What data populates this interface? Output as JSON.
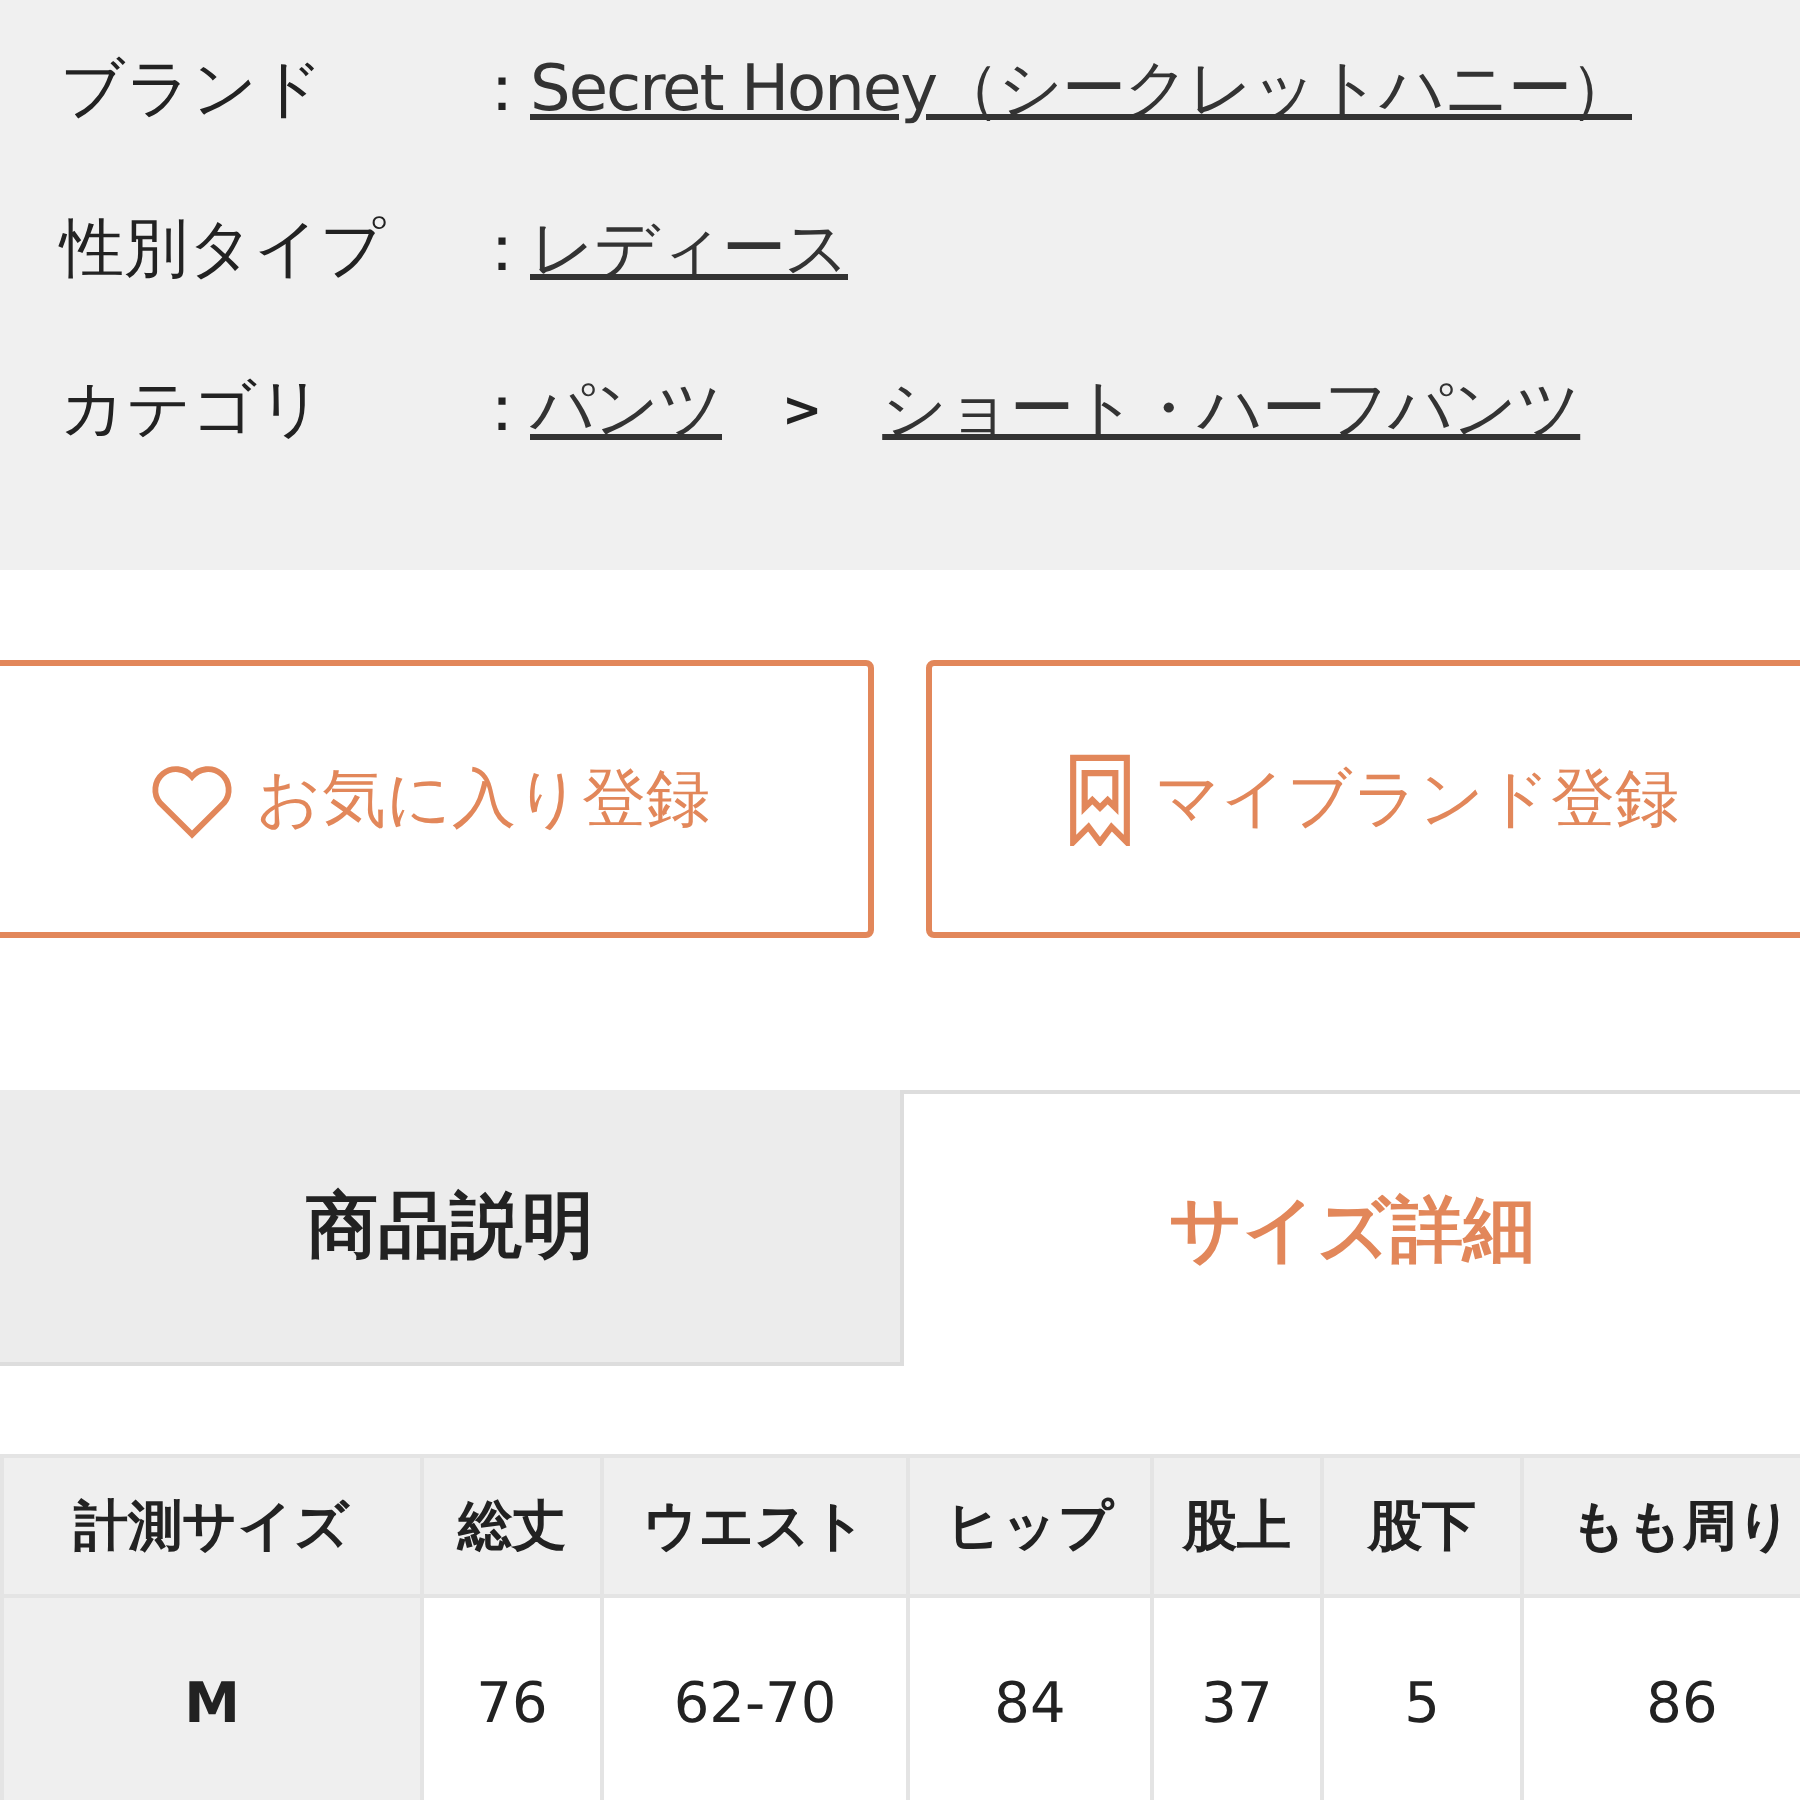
{
  "info": [
    {
      "label": "ブランド",
      "colon": "：",
      "links": [
        "Secret Honey（シークレットハニー）"
      ]
    },
    {
      "label": "性別タイプ",
      "colon": "：",
      "links": [
        "レディース"
      ]
    },
    {
      "label": "カテゴリ",
      "colon": "：",
      "links": [
        "パンツ",
        "ショート・ハーフパンツ"
      ],
      "separator": ">"
    }
  ],
  "buttons": [
    {
      "kind": "heart",
      "label": "お気に入り登録"
    },
    {
      "kind": "ribbon",
      "label": "マイブランド登録"
    }
  ],
  "tabs": [
    {
      "label": "商品説明",
      "selected": false
    },
    {
      "label": "サイズ詳細",
      "selected": true
    }
  ],
  "table": {
    "columns": [
      "計測サイズ",
      "総丈",
      "ウエスト",
      "ヒップ",
      "股上",
      "股下",
      "もも周り"
    ],
    "rows": [
      [
        "M",
        "76",
        "62-70",
        "84",
        "37",
        "5",
        "86"
      ]
    ]
  }
}
